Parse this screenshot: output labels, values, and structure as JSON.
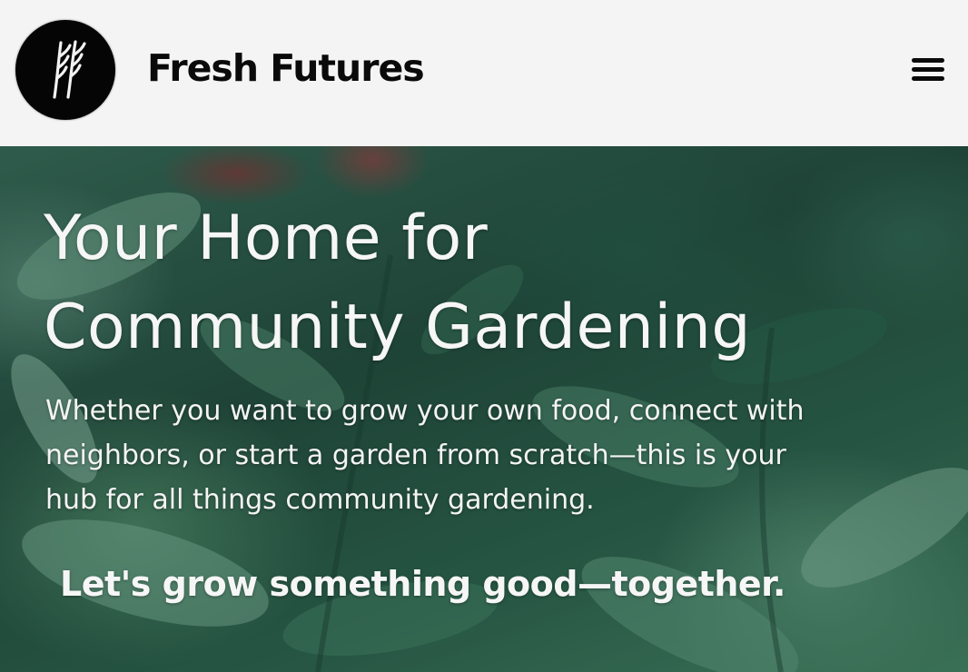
{
  "header": {
    "logo_icon": "wheat-sprig-logo-icon",
    "brand_name": "Fresh Futures",
    "menu_icon": "hamburger-menu-icon"
  },
  "hero": {
    "background": "blurred-garden-foliage-photo",
    "headline_line1": "Your Home for",
    "headline_line2": "Community Gardening",
    "subtext_line1": "Whether you want to grow your own food, connect with",
    "subtext_line2": "neighbors, or start a garden from scratch—this is your",
    "subtext_line3": "hub for all things community gardening.",
    "tagline": "Let's grow something good—together."
  },
  "colors": {
    "header_bg": "#f4f4f4",
    "brand_text": "#0a0a0a",
    "logo_bg": "#050505",
    "hero_text": "#f6f6f6",
    "hero_green": "#2f6650"
  }
}
